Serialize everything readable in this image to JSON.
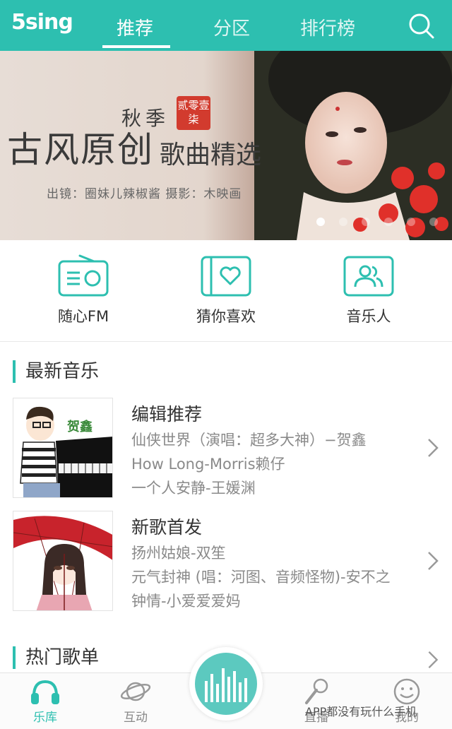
{
  "header": {
    "logo": "5sing",
    "tabs": [
      {
        "label": "推荐",
        "active": true
      },
      {
        "label": "分区",
        "active": false
      },
      {
        "label": "排行榜",
        "active": false
      }
    ],
    "search_icon": "search-icon",
    "bg_color": "#2dbfb0"
  },
  "banner": {
    "season": "秋季",
    "seal": "贰零壹柒",
    "title_a": "古风原创",
    "title_b": "歌曲精选",
    "credit": "出镜：圈妹儿辣椒酱   摄影：木映画",
    "active_slide": 1,
    "slide_count": 6
  },
  "quick_entries": [
    {
      "label": "随心FM",
      "icon": "radio-icon"
    },
    {
      "label": "猜你喜欢",
      "icon": "heart-book-icon"
    },
    {
      "label": "音乐人",
      "icon": "users-icon"
    }
  ],
  "latest_music": {
    "title": "最新音乐",
    "cards": [
      {
        "title": "编辑推荐",
        "lines": [
          "仙侠世界（演唱：超多大神）−贺鑫",
          "How Long-Morris赖仔",
          "一个人安静-王媛渊"
        ],
        "thumb_text": "贺鑫"
      },
      {
        "title": "新歌首发",
        "lines": [
          "扬州姑娘-双笙",
          "元气封神 (唱：河图、音频怪物)-安不之",
          "钟情-小爱爱爱妈"
        ]
      }
    ]
  },
  "hot_playlists": {
    "title": "热门歌单"
  },
  "bottom_nav": [
    {
      "label": "乐库",
      "icon": "headphones-icon",
      "active": true
    },
    {
      "label": "互动",
      "icon": "planet-icon",
      "active": false
    },
    {
      "label": "直播",
      "icon": "microphone-icon",
      "active": false
    },
    {
      "label": "我的",
      "icon": "smiley-icon",
      "active": false
    }
  ],
  "watermark": "APP都没有玩什么手机",
  "accent_color": "#2dbfb0"
}
